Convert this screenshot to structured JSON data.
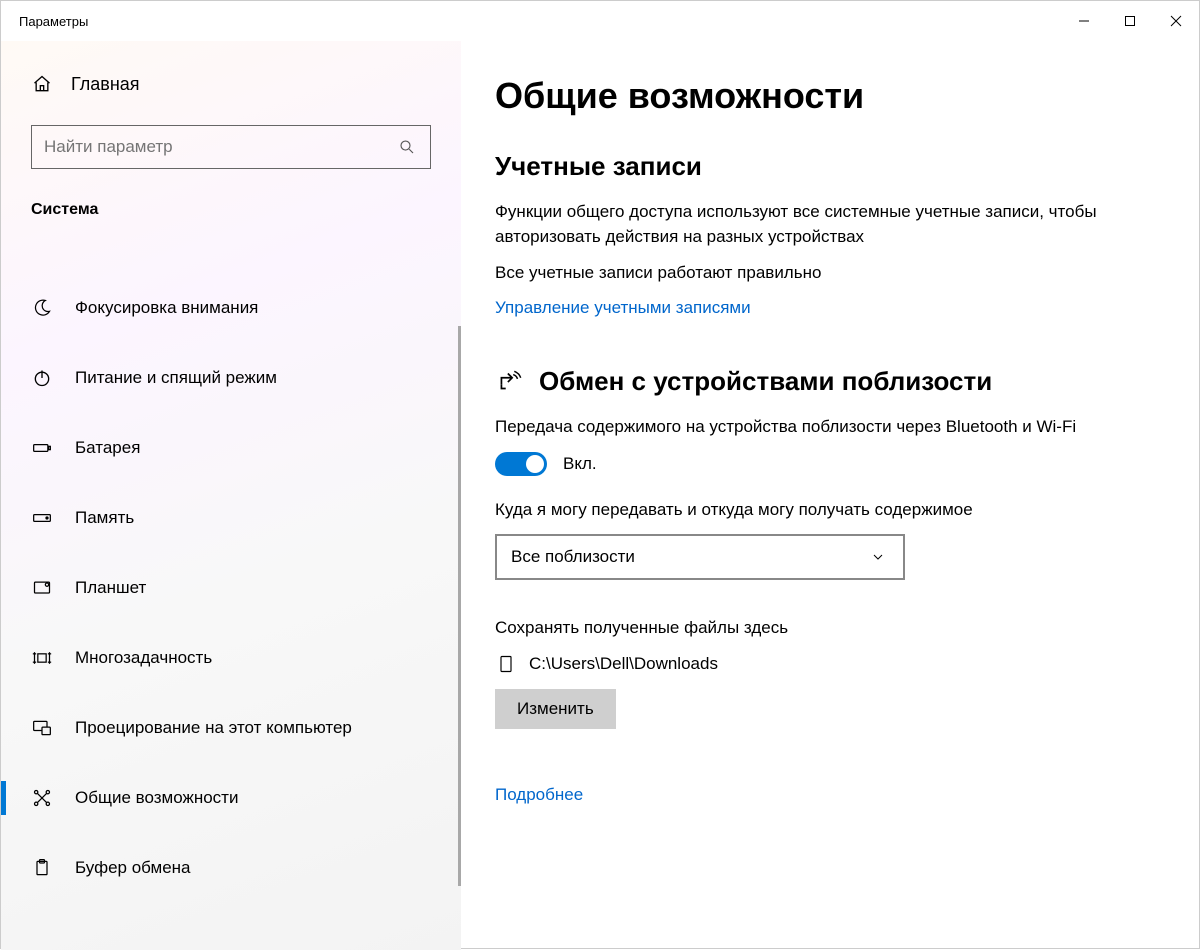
{
  "window": {
    "title": "Параметры"
  },
  "sidebar": {
    "home": "Главная",
    "search_placeholder": "Найти параметр",
    "category": "Система",
    "items": [
      {
        "label": "Фокусировка внимания",
        "icon": "moon"
      },
      {
        "label": "Питание и спящий режим",
        "icon": "power"
      },
      {
        "label": "Батарея",
        "icon": "battery"
      },
      {
        "label": "Память",
        "icon": "storage"
      },
      {
        "label": "Планшет",
        "icon": "tablet"
      },
      {
        "label": "Многозадачность",
        "icon": "multitask"
      },
      {
        "label": "Проецирование на этот компьютер",
        "icon": "project"
      },
      {
        "label": "Общие возможности",
        "icon": "share",
        "active": true
      },
      {
        "label": "Буфер обмена",
        "icon": "clipboard"
      }
    ]
  },
  "main": {
    "title": "Общие возможности",
    "accounts": {
      "heading": "Учетные записи",
      "desc": "Функции общего доступа используют все системные учетные записи, чтобы авторизовать действия на разных устройствах",
      "status": "Все учетные записи работают правильно",
      "link": "Управление учетными записями"
    },
    "nearby": {
      "heading": "Обмен с устройствами поблизости",
      "desc": "Передача содержимого на устройства поблизости через Bluetooth и Wi-Fi",
      "toggle_state": "Вкл.",
      "scope_label": "Куда я могу передавать и откуда могу получать содержимое",
      "scope_value": "Все поблизости",
      "save_to_label": "Сохранять полученные файлы здесь",
      "save_to_path": "C:\\Users\\Dell\\Downloads",
      "change_btn": "Изменить",
      "more_link": "Подробнее"
    }
  }
}
